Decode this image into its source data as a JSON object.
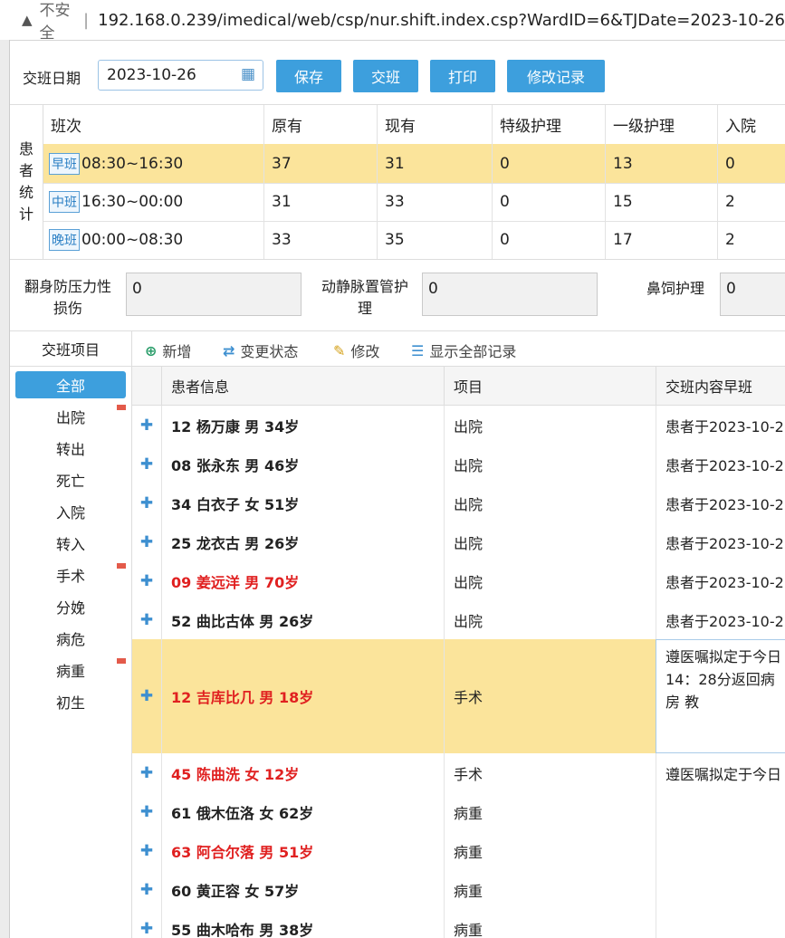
{
  "browser": {
    "security_icon": "warning-triangle",
    "security_label": "不安全",
    "url": "192.168.0.239/imedical/web/csp/nur.shift.index.csp?WardID=6&TJDate=2023-10-26"
  },
  "toolbar": {
    "date_label": "交班日期",
    "date_value": "2023-10-26",
    "save": "保存",
    "shift": "交班",
    "print": "打印",
    "history": "修改记录"
  },
  "stats": {
    "side_label": [
      "患",
      "者",
      "统",
      "计"
    ],
    "headers": [
      "班次",
      "原有",
      "现有",
      "特级护理",
      "一级护理",
      "入院"
    ],
    "rows": [
      {
        "tag": "早班",
        "time": "08:30~16:30",
        "orig": "37",
        "now": "31",
        "special": "0",
        "first": "13",
        "admit": "0"
      },
      {
        "tag": "中班",
        "time": "16:30~00:00",
        "orig": "31",
        "now": "33",
        "special": "0",
        "first": "15",
        "admit": "2"
      },
      {
        "tag": "晚班",
        "time": "00:00~08:30",
        "orig": "33",
        "now": "35",
        "special": "0",
        "first": "17",
        "admit": "2"
      }
    ]
  },
  "extra": {
    "f1_label1": "翻身防压力性",
    "f1_label2": "损伤",
    "f1_value": "0",
    "f2_label1": "动静脉置管护",
    "f2_label2": "理",
    "f2_value": "0",
    "f3_label": "鼻饲护理",
    "f3_value": "0"
  },
  "sidebar": {
    "title": "交班项目",
    "items": [
      {
        "label": "全部"
      },
      {
        "label": "出院"
      },
      {
        "label": "转出"
      },
      {
        "label": "死亡"
      },
      {
        "label": "入院"
      },
      {
        "label": "转入"
      },
      {
        "label": "手术"
      },
      {
        "label": "分娩"
      },
      {
        "label": "病危"
      },
      {
        "label": "病重"
      },
      {
        "label": "初生"
      }
    ]
  },
  "grid": {
    "tools": {
      "add": "新增",
      "change": "变更状态",
      "edit": "修改",
      "showall": "显示全部记录"
    },
    "headers": {
      "patient": "患者信息",
      "item": "项目",
      "content": "交班内容早班"
    },
    "rows": [
      {
        "patient": "12 杨万康 男 34岁",
        "item": "出院",
        "content": "患者于2023-10-2"
      },
      {
        "patient": "08 张永东 男 46岁",
        "item": "出院",
        "content": "患者于2023-10-2"
      },
      {
        "patient": "34 白衣子 女 51岁",
        "item": "出院",
        "content": "患者于2023-10-2"
      },
      {
        "patient": "25 龙衣古 男 26岁",
        "item": "出院",
        "content": "患者于2023-10-2"
      },
      {
        "patient": "09 姜远洋 男 70岁",
        "item": "出院",
        "content": "患者于2023-10-2"
      },
      {
        "patient": "52 曲比古体 男 26岁",
        "item": "出院",
        "content": "患者于2023-10-2"
      },
      {
        "patient": "12 吉库比几 男 18岁",
        "item": "手术",
        "content": "遵医嘱拟定于今日 14：28分返回病房 教"
      },
      {
        "patient": "45 陈曲洗 女 12岁",
        "item": "手术",
        "content": "遵医嘱拟定于今日"
      },
      {
        "patient": "61 俄木伍洛 女 62岁",
        "item": "病重",
        "content": ""
      },
      {
        "patient": "63 阿合尔落 男 51岁",
        "item": "病重",
        "content": ""
      },
      {
        "patient": "60 黄正容 女 57岁",
        "item": "病重",
        "content": ""
      },
      {
        "patient": "55 曲木哈布 男 38岁",
        "item": "病重",
        "content": ""
      }
    ]
  },
  "colors": {
    "accent": "#3d9fdd",
    "highlight": "#fbe49b",
    "alert_red": "#e02020"
  }
}
